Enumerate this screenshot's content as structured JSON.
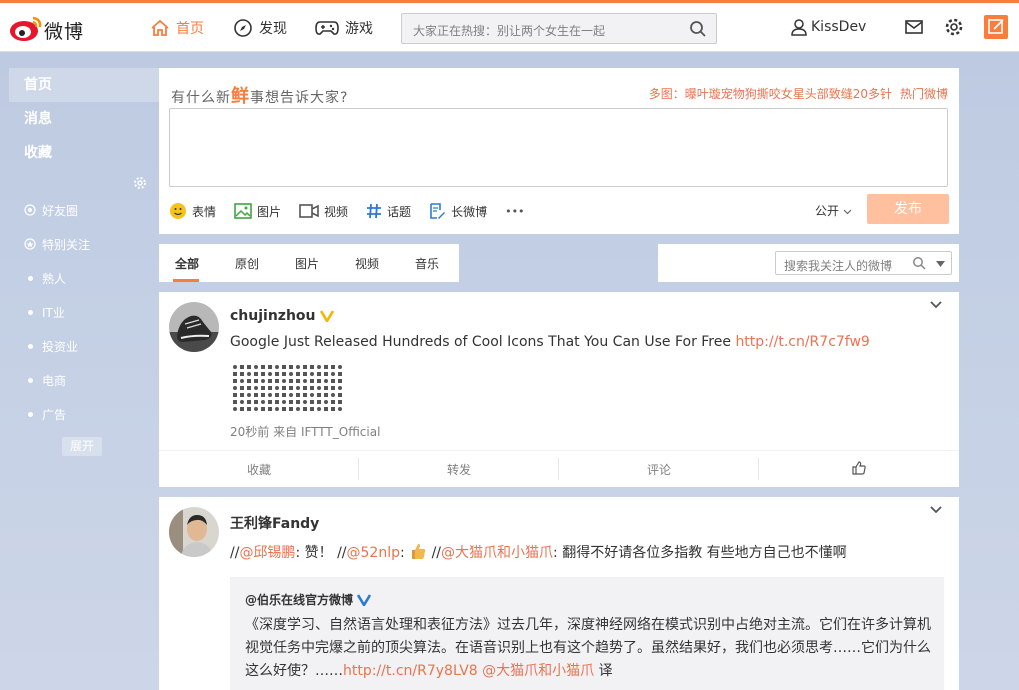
{
  "header": {
    "logo_text": "微博",
    "nav": {
      "home": "首页",
      "discover": "发现",
      "games": "游戏"
    },
    "search_placeholder": "大家正在热搜：别让两个女生在一起",
    "username": "KissDev",
    "icons": [
      "mail-icon",
      "gear-icon",
      "compose-icon"
    ],
    "accent_color": "#fa7d3c"
  },
  "sidebar": {
    "main": [
      "首页",
      "消息",
      "收藏"
    ],
    "groups": [
      {
        "label": "好友圈",
        "icon": "friends-circle-icon"
      },
      {
        "label": "特别关注",
        "icon": "special-follow-icon"
      },
      {
        "label": "熟人",
        "icon": "dot"
      },
      {
        "label": "IT业",
        "icon": "dot"
      },
      {
        "label": "投资业",
        "icon": "dot"
      },
      {
        "label": "电商",
        "icon": "dot"
      },
      {
        "label": "广告",
        "icon": "dot"
      }
    ],
    "expand": "展开"
  },
  "publisher": {
    "prompt": "有什么新鲜事想告诉大家?",
    "prompt_highlight": "鲜",
    "hot_topic": "多图：曝叶璇宠物狗撕咬女星头部致缝20多针",
    "hot_link": "热门微博",
    "tools": [
      "表情",
      "图片",
      "视频",
      "话题",
      "长微博"
    ],
    "more": "•••",
    "visibility": "公开",
    "submit": "发布"
  },
  "feed_tabs": [
    "全部",
    "原创",
    "图片",
    "视频",
    "音乐"
  ],
  "feed_search_placeholder": "搜索我关注人的微博",
  "posts": [
    {
      "author": "chujinzhou",
      "verified": true,
      "text": "Google Just Released Hundreds of Cool Icons That You Can Use For Free ",
      "link": "http://t.cn/R7c7fw9",
      "time": "20秒前",
      "source_prefix": "来自",
      "source": "IFTTT_Official",
      "actions": [
        "收藏",
        "转发",
        "评论"
      ]
    },
    {
      "author": "王利锋Fandy",
      "comment_chain": [
        {
          "prefix": "//",
          "mention": "@邱锡鹏",
          "text": ": 赞！"
        },
        {
          "prefix": "//",
          "mention": "@52nlp",
          "text": ": "
        },
        {
          "prefix": "//",
          "mention": "@大猫爪和小猫爪",
          "text": ": 翻得不好请各位多指教 有些地方自己也不懂啊"
        }
      ],
      "retweet": {
        "author": "@伯乐在线官方微博",
        "text": "《深度学习、自然语言处理和表征方法》过去几年，深度神经网络在模式识别中占绝对主流。它们在许多计算机视觉任务中完爆之前的顶尖算法。在语音识别上也有这个趋势了。虽然结果好，我们也必须思考……它们为什么这么好使？……",
        "link": "http://t.cn/R7y8LV8",
        "mention": "@大猫爪和小猫爪",
        "suffix": " 译"
      }
    }
  ]
}
